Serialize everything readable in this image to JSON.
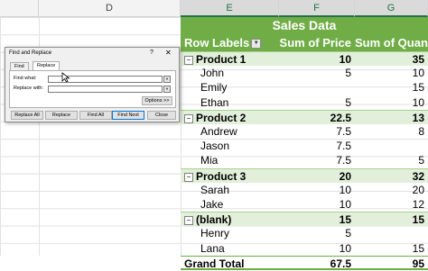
{
  "columns": [
    {
      "label": ""
    },
    {
      "label": "D"
    },
    {
      "label": "E"
    },
    {
      "label": "F"
    },
    {
      "label": "G"
    }
  ],
  "pivot": {
    "title": "Sales Data",
    "headers": [
      "Row Labels",
      "Sum of Price",
      "Sum of Quantity"
    ],
    "rows": [
      {
        "type": "group",
        "label": "Product 1",
        "price": "10",
        "qty": "35"
      },
      {
        "type": "child",
        "label": "John",
        "price": "5",
        "qty": "10"
      },
      {
        "type": "child",
        "label": "Emily",
        "price": "",
        "qty": "15"
      },
      {
        "type": "child",
        "label": "Ethan",
        "price": "5",
        "qty": "10"
      },
      {
        "type": "group",
        "label": "Product 2",
        "price": "22.5",
        "qty": "13"
      },
      {
        "type": "child",
        "label": "Andrew",
        "price": "7.5",
        "qty": "8"
      },
      {
        "type": "child",
        "label": "Jason",
        "price": "7.5",
        "qty": ""
      },
      {
        "type": "child",
        "label": "Mia",
        "price": "7.5",
        "qty": "5"
      },
      {
        "type": "group",
        "label": "Product 3",
        "price": "20",
        "qty": "32"
      },
      {
        "type": "child",
        "label": "Sarah",
        "price": "10",
        "qty": "20"
      },
      {
        "type": "child",
        "label": "Jake",
        "price": "10",
        "qty": "12"
      },
      {
        "type": "group",
        "label": "(blank)",
        "price": "15",
        "qty": "15"
      },
      {
        "type": "child",
        "label": "Henry",
        "price": "5",
        "qty": ""
      },
      {
        "type": "child",
        "label": "Lana",
        "price": "10",
        "qty": "15"
      },
      {
        "type": "total",
        "label": "Grand Total",
        "price": "67.5",
        "qty": "95"
      }
    ]
  },
  "dialog": {
    "title": "Find and Replace",
    "help": "?",
    "close": "✕",
    "tabs": [
      "Find",
      "Replace"
    ],
    "find_label": "Find what:",
    "replace_label": "Replace with:",
    "find_value": "",
    "replace_value": "",
    "options_button": "Options >>",
    "buttons": [
      "Replace All",
      "Replace",
      "Find All",
      "Find Next",
      "Close"
    ]
  },
  "colors": {
    "accent": "#70ad47",
    "group_fill": "#e2efda"
  }
}
